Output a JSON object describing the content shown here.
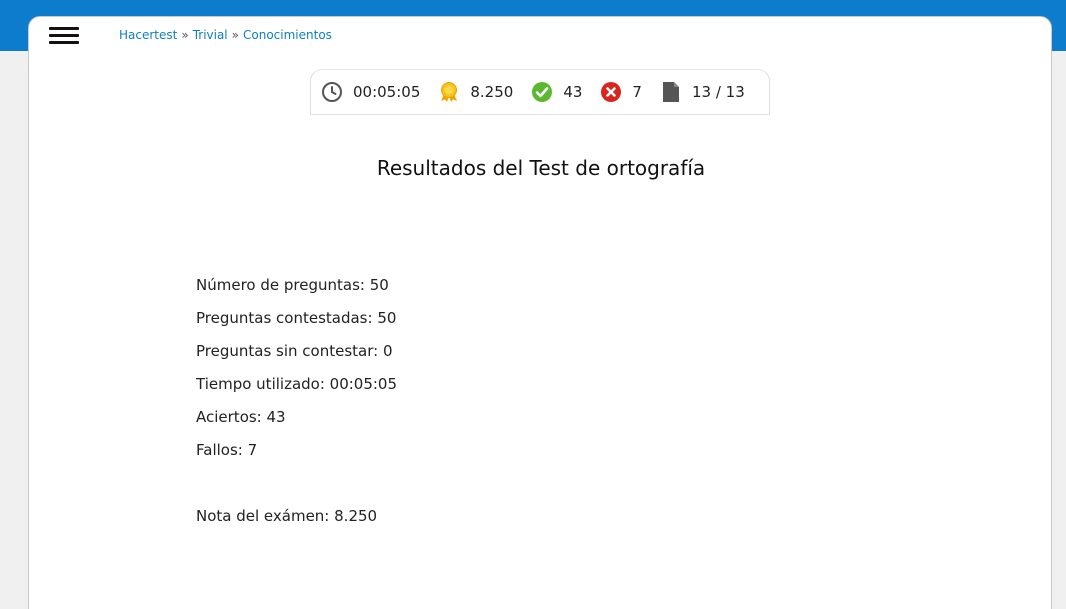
{
  "breadcrumb": {
    "items": [
      "Hacertest",
      "Trivial",
      "Conocimientos"
    ],
    "separator": "»"
  },
  "stats": {
    "time": "00:05:05",
    "score": "8.250",
    "correct": "43",
    "wrong": "7",
    "pages": "13 / 13"
  },
  "icons": {
    "time": "clock-icon",
    "score": "medal-icon",
    "correct": "check-circle-icon",
    "wrong": "x-circle-icon",
    "pages": "document-icon"
  },
  "colors": {
    "header_band": "#0d7ccc",
    "link": "#0e7fc0",
    "check_green": "#5cb82e",
    "cross_red": "#d9251d",
    "medal_gold": "#f5b400"
  },
  "title": "Resultados del Test de ortografía",
  "results": {
    "questions": "Número de preguntas: 50",
    "answered": "Preguntas contestadas: 50",
    "unanswered": "Preguntas sin contestar: 0",
    "time_used": "Tiempo utilizado: 00:05:05",
    "hits": "Aciertos: 43",
    "misses": "Fallos: 7",
    "grade": "Nota del exámen: 8.250"
  }
}
